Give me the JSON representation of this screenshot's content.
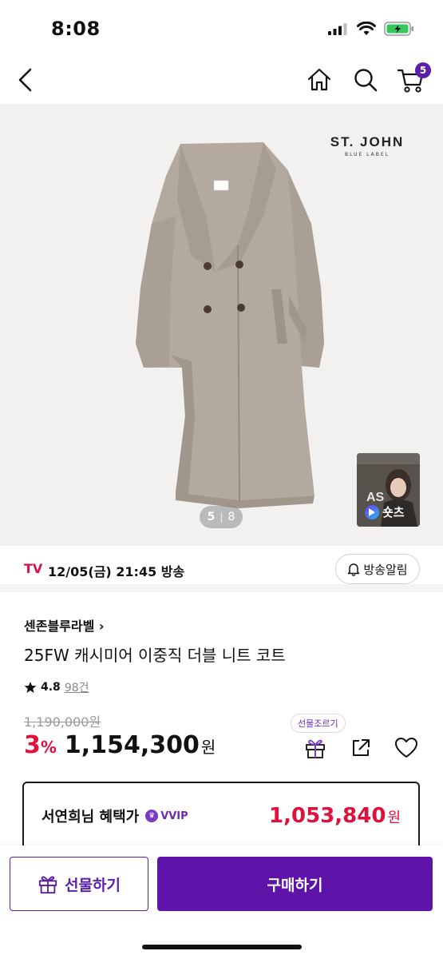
{
  "status": {
    "time": "8:08"
  },
  "nav": {
    "cart_count": "5"
  },
  "hero": {
    "brand_logo_line1": "ST. JOHN",
    "brand_logo_line2": "BLUE LABEL",
    "pager_current": "5",
    "pager_total": "8",
    "shorts_label": "숏츠"
  },
  "broadcast": {
    "tv_label": "TV",
    "schedule": "12/05(금) 21:45 방송",
    "alert_label": "방송알림"
  },
  "product": {
    "brand": "센존블루라벨",
    "title": "25FW 캐시미어 이중직 더블 니트 코트",
    "rating": "4.8",
    "review_count": "98건",
    "original_price": "1,190,000원",
    "discount": "3",
    "discount_unit": "%",
    "price": "1,154,300",
    "price_unit": "원",
    "gift_tooltip": "선물조르기"
  },
  "benefit": {
    "title": "서연희님 혜택가",
    "grade": "VVIP",
    "price": "1,053,840",
    "price_unit": "원"
  },
  "actions": {
    "gift_label": "선물하기",
    "buy_label": "구매하기"
  },
  "colors": {
    "brand_purple": "#5e14a8",
    "discount_red": "#e0103d",
    "coat": "#b5aba0"
  },
  "icons": [
    "back-icon",
    "home-icon",
    "search-icon",
    "cart-icon",
    "bell-icon",
    "gift-icon",
    "share-icon",
    "heart-icon",
    "star-icon",
    "play-icon"
  ]
}
